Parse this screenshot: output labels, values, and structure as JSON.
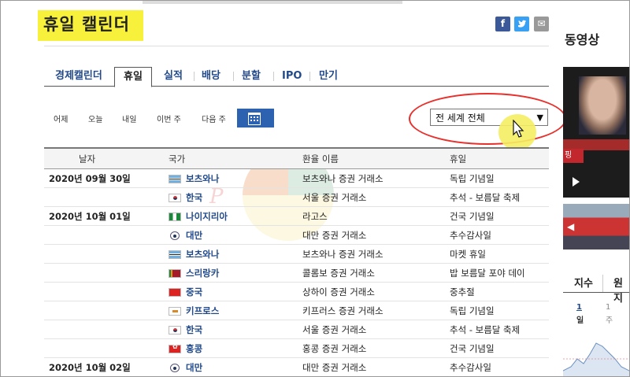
{
  "header": {
    "title": "휴일 캘린더"
  },
  "social": {
    "facebook": "f",
    "twitter": "t",
    "mail": "✉"
  },
  "tabs": [
    "경제캘린더",
    "휴일",
    "실적",
    "배당",
    "분할",
    "IPO",
    "만기"
  ],
  "active_tab": "휴일",
  "day_buttons": [
    "어제",
    "오늘",
    "내일",
    "이번 주",
    "다음 주"
  ],
  "region_select": {
    "value": "전 세계 전체"
  },
  "table": {
    "headers": [
      "날자",
      "국가",
      "환율 이름",
      "휴일"
    ],
    "rows": [
      {
        "date": "2020년 09월 30일",
        "flag": "bw",
        "country": "보츠와나",
        "exchange": "보츠와나 증권 거래소",
        "holiday": "독립 기념일"
      },
      {
        "date": "",
        "flag": "kr",
        "country": "한국",
        "exchange": "서울 증권 거래소",
        "holiday": "추석 - 보름달 축제"
      },
      {
        "date": "2020년 10월 01일",
        "flag": "ng",
        "country": "나이지리아",
        "exchange": "라고스",
        "holiday": "건국 기념일"
      },
      {
        "date": "",
        "flag": "tw",
        "country": "대만",
        "exchange": "대만 증권 거래소",
        "holiday": "추수감사일"
      },
      {
        "date": "",
        "flag": "bw",
        "country": "보츠와나",
        "exchange": "보츠와나 증권 거래소",
        "holiday": "마켓 휴일"
      },
      {
        "date": "",
        "flag": "lk",
        "country": "스리랑카",
        "exchange": "콜롬보 증권 거래소",
        "holiday": "밥 보름달 포야 데이"
      },
      {
        "date": "",
        "flag": "cn",
        "country": "중국",
        "exchange": "상하이 증권 거래소",
        "holiday": "중추절"
      },
      {
        "date": "",
        "flag": "cy",
        "country": "키프로스",
        "exchange": "키프러스 증권 거래소",
        "holiday": "독립 기념일"
      },
      {
        "date": "",
        "flag": "kr",
        "country": "한국",
        "exchange": "서울 증권 거래소",
        "holiday": "추석 - 보름달 축제"
      },
      {
        "date": "",
        "flag": "hk",
        "country": "홍콩",
        "exchange": "홍콩 증권 거래소",
        "holiday": "건국 기념일"
      },
      {
        "date": "2020년 10월 02일",
        "flag": "tw",
        "country": "대만",
        "exchange": "대만 증권 거래소",
        "holiday": "추수감사일"
      }
    ]
  },
  "sidebar": {
    "title": "동영상",
    "video_banner": "핑",
    "tabs": [
      "지수",
      "원지"
    ],
    "period_1": "1",
    "period_1_unit": "일",
    "period_2": "1",
    "period_2_unit": "주"
  },
  "watermark": "Part"
}
